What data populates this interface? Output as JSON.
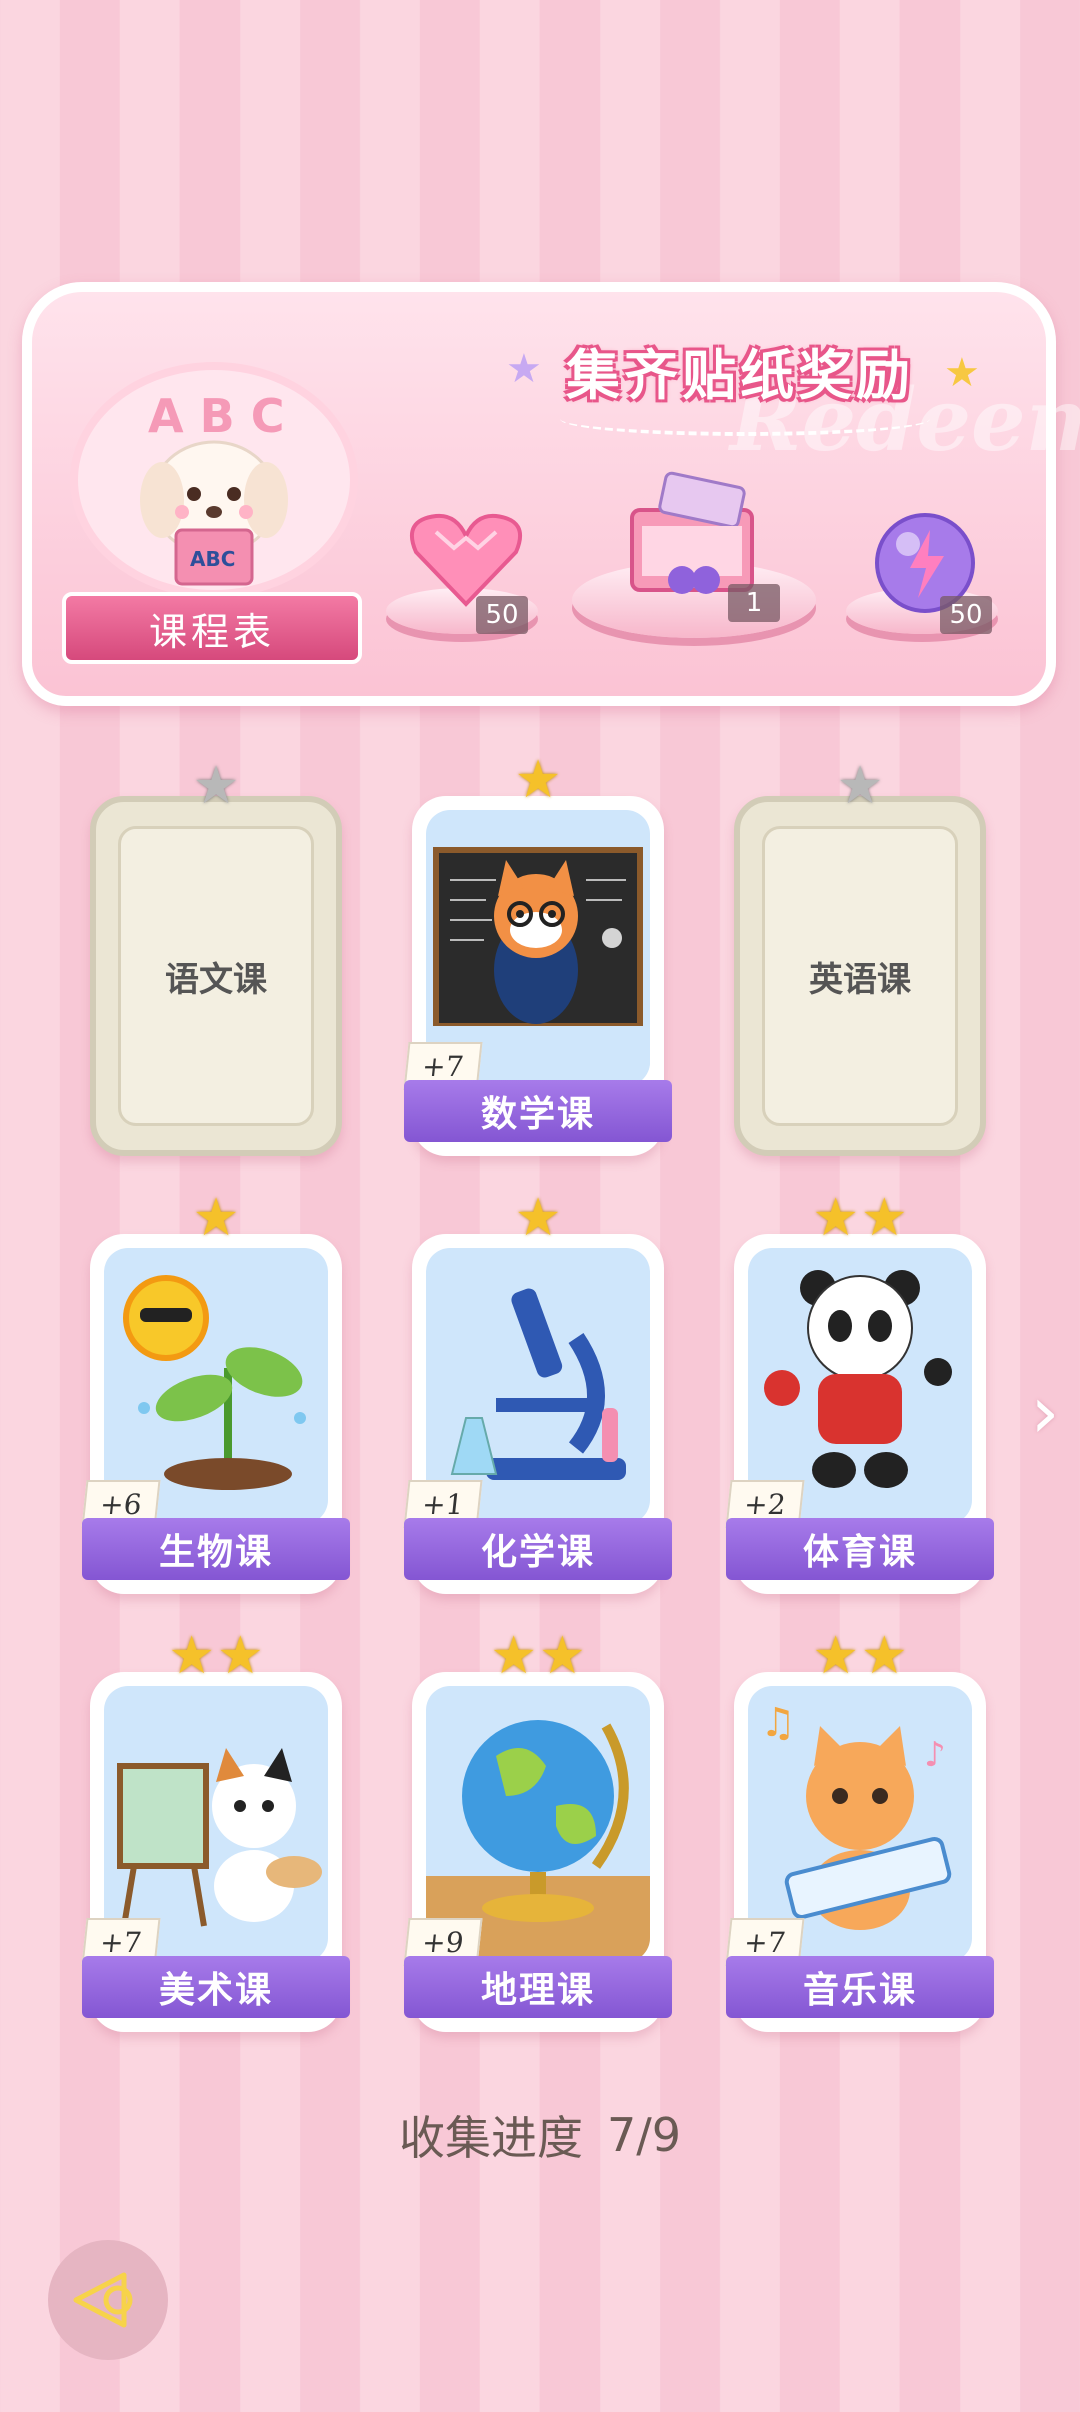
{
  "banner": {
    "title": "集齐贴纸奖励",
    "watermark": "Redeem",
    "schedule_button_label": "课程表",
    "book_label": "ABC",
    "abc_letters": "A B C",
    "rewards": [
      {
        "name": "heart-gem",
        "count": "50"
      },
      {
        "name": "gift-box",
        "count": "1"
      },
      {
        "name": "energy-orb",
        "count": "50"
      }
    ]
  },
  "courses": [
    {
      "label": "语文课",
      "unlocked": false,
      "stars": 1,
      "star_color": "gray",
      "bonus": ""
    },
    {
      "label": "数学课",
      "unlocked": true,
      "stars": 1,
      "star_color": "gold",
      "bonus": "+7",
      "art": "fox-teacher-chalkboard"
    },
    {
      "label": "英语课",
      "unlocked": false,
      "stars": 1,
      "star_color": "gray",
      "bonus": ""
    },
    {
      "label": "生物课",
      "unlocked": true,
      "stars": 1,
      "star_color": "gold",
      "bonus": "+6",
      "art": "sun-and-sprout"
    },
    {
      "label": "化学课",
      "unlocked": true,
      "stars": 1,
      "star_color": "gold",
      "bonus": "+1",
      "art": "microscope"
    },
    {
      "label": "体育课",
      "unlocked": true,
      "stars": 2,
      "star_color": "gold",
      "bonus": "+2",
      "art": "panda-ping-pong"
    },
    {
      "label": "美术课",
      "unlocked": true,
      "stars": 2,
      "star_color": "gold",
      "bonus": "+7",
      "art": "cat-painter"
    },
    {
      "label": "地理课",
      "unlocked": true,
      "stars": 2,
      "star_color": "gold",
      "bonus": "+9",
      "art": "globe"
    },
    {
      "label": "音乐课",
      "unlocked": true,
      "stars": 2,
      "star_color": "gold",
      "bonus": "+7",
      "art": "cat-keyboard"
    }
  ],
  "progress": {
    "label": "收集进度",
    "value": "7/9"
  },
  "colors": {
    "label_purple": "#8f62dc",
    "banner_pink": "#f7b7cb",
    "star_gold": "#f5c12a"
  }
}
